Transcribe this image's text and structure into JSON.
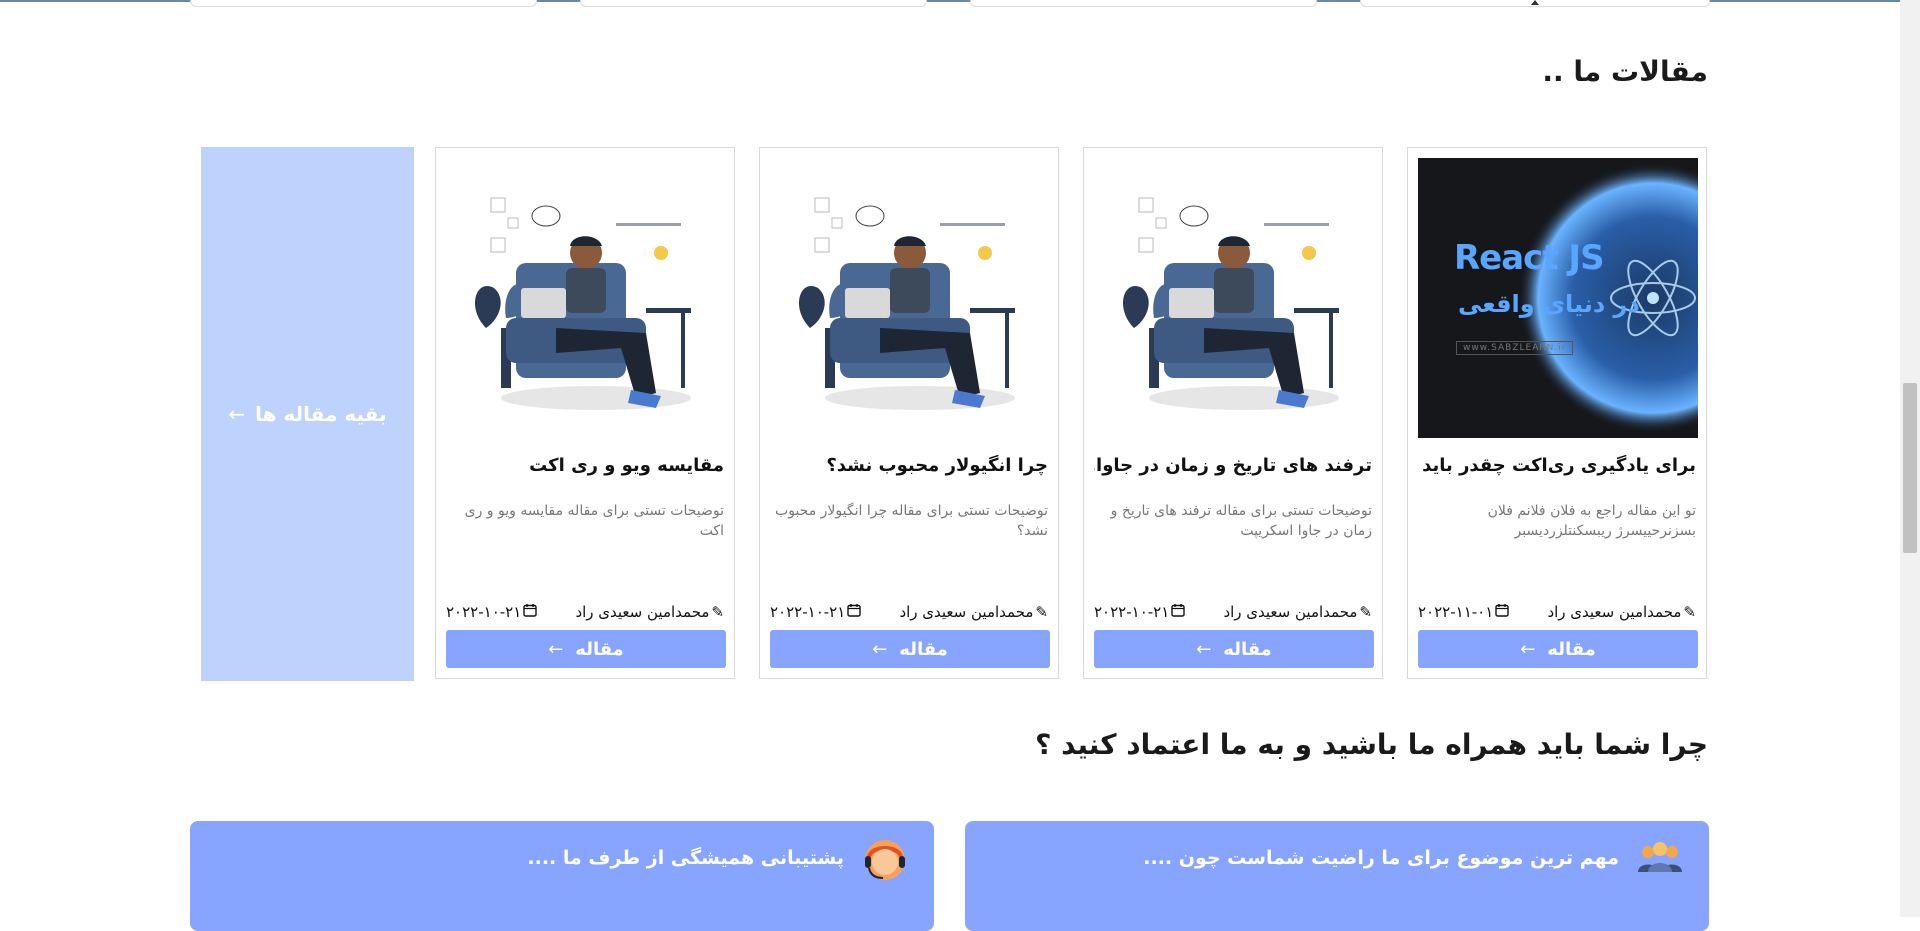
{
  "articles_section": {
    "title": "مقالات ما ..",
    "more_label": "بقیه مقاله ها",
    "more_arrow": "←",
    "cards": [
      {
        "image": "react-js-cover",
        "thumb_title": "React JS",
        "thumb_subtitle": "در دنیای واقعی",
        "thumb_footer": "www.SABZLEARN.ir",
        "title": "برای یادگیری ری‌اکت چقدر باید ج...",
        "description": "تو این مقاله راجع به فلان فلانم فلان بسزنرحییسرژ ریبسکنتلزردیسبر",
        "author": "محمدامین سعیدی راد",
        "date": "۲۰۲۲-۱۱-۰۱",
        "button_label": "مقاله",
        "button_arrow": "←"
      },
      {
        "image": "developer-illustration",
        "title": "ترفند های تاریخ و زمان در جاوا...",
        "description": "توضیحات تستی برای مقاله ترفند های تاریخ و زمان در جاوا اسکریپت",
        "author": "محمدامین سعیدی راد",
        "date": "۲۰۲۲-۱۰-۲۱",
        "button_label": "مقاله",
        "button_arrow": "←"
      },
      {
        "image": "developer-illustration",
        "title": "چرا انگیولار محبوب نشد؟",
        "description": "توضیحات تستی برای مقاله چرا انگیولار محبوب نشد؟",
        "author": "محمدامین سعیدی راد",
        "date": "۲۰۲۲-۱۰-۲۱",
        "button_label": "مقاله",
        "button_arrow": "←"
      },
      {
        "image": "developer-illustration",
        "title": "مقایسه ویو و ری اکت",
        "description": "توضیحات تستی برای مقاله مقایسه ویو و ری اکت",
        "author": "محمدامین سعیدی راد",
        "date": "۲۰۲۲-۱۰-۲۱",
        "button_label": "مقاله",
        "button_arrow": "←"
      }
    ]
  },
  "trust_section": {
    "title": "چرا شما باید همراه ما باشید و به ما اعتماد کنید ؟",
    "features": [
      {
        "text": "مهم ترین موضوع برای ما راضیت شماست چون ....",
        "icon": "team-icon"
      },
      {
        "text": "پشتیبانی همیشگی از طرف ما ....",
        "icon": "support-agent-icon"
      }
    ]
  },
  "colors": {
    "accent": "#87a5ff",
    "more_panel": "#bed2fe",
    "card_border": "#d9d9d9",
    "description": "#777777"
  }
}
